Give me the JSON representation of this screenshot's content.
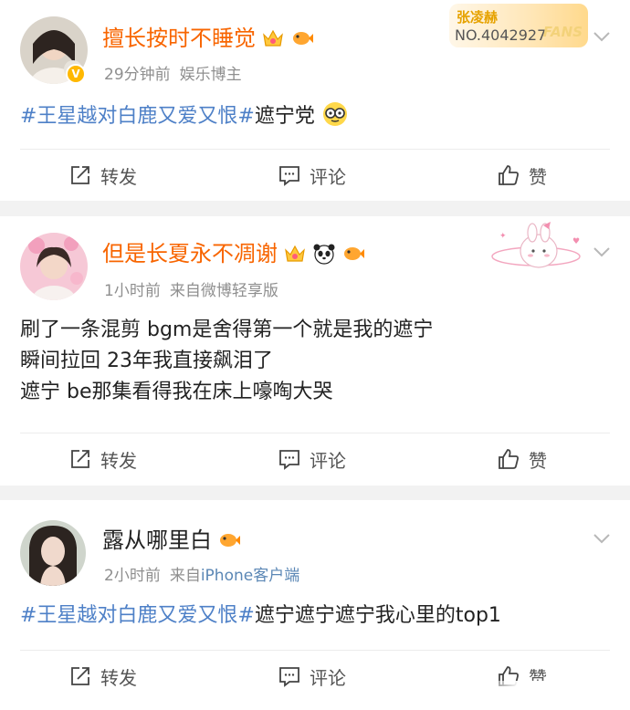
{
  "posts": [
    {
      "username": "擅长按时不睡觉",
      "time": "29分钟前",
      "source": "娱乐博主",
      "source_prefix": "",
      "fans_card": {
        "name": "张凌赫",
        "number": "NO.4042927",
        "word": "FANS"
      },
      "hashtag": "#王星越对白鹿又爱又恨#",
      "text": "遮宁党",
      "actions": {
        "repost": "转发",
        "comment": "评论",
        "like": "赞"
      }
    },
    {
      "username": "但是长夏永不凋谢",
      "time": "1小时前",
      "source_prefix": "来自",
      "source": "微博轻享版",
      "lines": [
        "刷了一条混剪 bgm是舍得第一个就是我的遮宁",
        "瞬间拉回 23年我直接飙泪了",
        "遮宁 be那集看得我在床上嚎啕大哭"
      ],
      "actions": {
        "repost": "转发",
        "comment": "评论",
        "like": "赞"
      }
    },
    {
      "username": "露从哪里白",
      "time": "2小时前",
      "source_prefix": "来自",
      "source": "iPhone客户端",
      "hashtag": "#王星越对白鹿又爱又恨#",
      "text": "遮宁遮宁遮宁我心里的top1",
      "actions": {
        "repost": "转发",
        "comment": "评论",
        "like": "赞"
      }
    }
  ],
  "colors": {
    "vip_name": "#f86500",
    "hashtag": "#4e80c7",
    "meta": "#8f8f8f",
    "source_link": "#5b87b5",
    "background": "#f2f2f2"
  },
  "icons": {
    "repost": "repost-icon",
    "comment": "comment-icon",
    "like": "thumbs-up-icon",
    "more": "chevron-down-icon",
    "vip_crown": "crown-icon",
    "fish": "fish-icon",
    "panda": "panda-icon",
    "glasses_emoji": "nerd-glasses-emoji"
  }
}
